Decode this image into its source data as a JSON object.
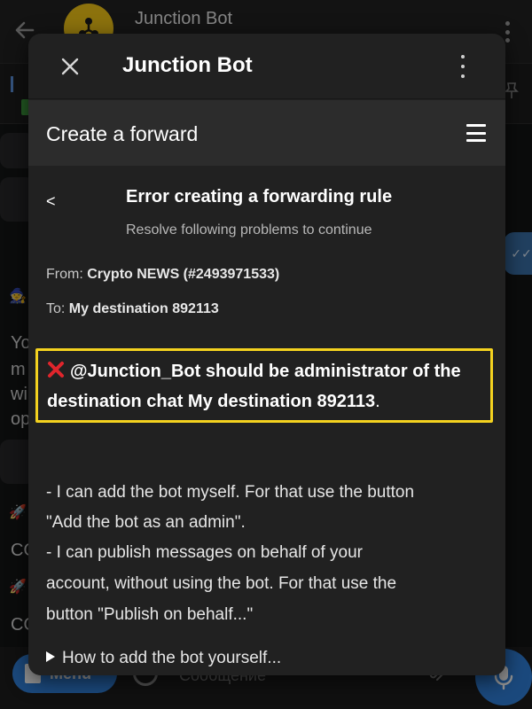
{
  "background_chat": {
    "title": "Junction Bot",
    "left_texts": [
      "Yo",
      "m",
      "wi",
      "op"
    ],
    "left_labels": [
      "CO",
      "CO"
    ],
    "menu_label": "Menu",
    "message_placeholder": "Сообщение"
  },
  "modal": {
    "title": "Junction Bot",
    "close_icon": "close-icon",
    "more_icon": "more-vertical-icon"
  },
  "app": {
    "navbar_title": "Create a forward",
    "back_label": "<",
    "error_title": "Error creating a forwarding rule",
    "error_subtitle": "Resolve following problems to continue",
    "from_label": "From:",
    "from_value": "Crypto NEWS (#2493971533)",
    "to_label": "To:",
    "to_value": "My destination 892113",
    "error_line_1": "@Junction_Bot should be administrator of the",
    "error_line_2_bold": "destination chat My destination 892113",
    "error_line_2_tail": ".",
    "desc_lines": [
      "- I can add the bot myself. For that use the button",
      "\"Add the bot as an admin\".",
      "- I can publish messages on behalf of your",
      "account, without using the bot. For that use the",
      "button \"Publish on behalf...\""
    ],
    "howto_label": "How to add the bot yourself...",
    "highlight_color": "#f4d21f",
    "error_icon_color": "#e0252c"
  }
}
